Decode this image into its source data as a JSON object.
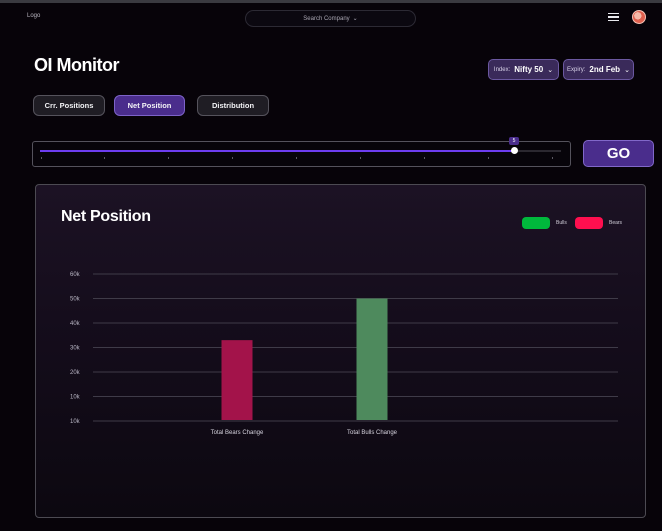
{
  "header": {
    "logo": "Logo",
    "search_placeholder": "Search Company",
    "chevron": "⌄",
    "menu_icon": "hamburger-icon",
    "avatar_icon": "avatar"
  },
  "page": {
    "title": "OI Monitor",
    "index_label": "Index:",
    "index_value": "Nifty 50",
    "expiry_label": "Expiry:",
    "expiry_value": "2nd Feb",
    "tabs": [
      "Crr. Positions",
      "Net Position",
      "Distribution"
    ],
    "active_tab": "Net Position",
    "slider_value": "5",
    "slider_fraction": 0.9,
    "go_label": "GO"
  },
  "colors": {
    "accent": "#4a2d8c",
    "bulls": "#00b83c",
    "bears": "#ff0f4f",
    "bar_bears": "#a3134a",
    "bar_bulls": "#4e8a5d"
  },
  "chart_data": {
    "type": "bar",
    "title": "Net Position",
    "categories": [
      "Total Bears Change",
      "Total Bulls Change"
    ],
    "values": [
      33000,
      50000
    ],
    "series_colors": [
      "#a3134a",
      "#4e8a5d"
    ],
    "yticks": [
      "60k",
      "50k",
      "40k",
      "30k",
      "20k",
      "10k",
      "10k"
    ],
    "legend": [
      "Bulls",
      "Bears"
    ],
    "legend_position": "top-right",
    "grid": true
  }
}
